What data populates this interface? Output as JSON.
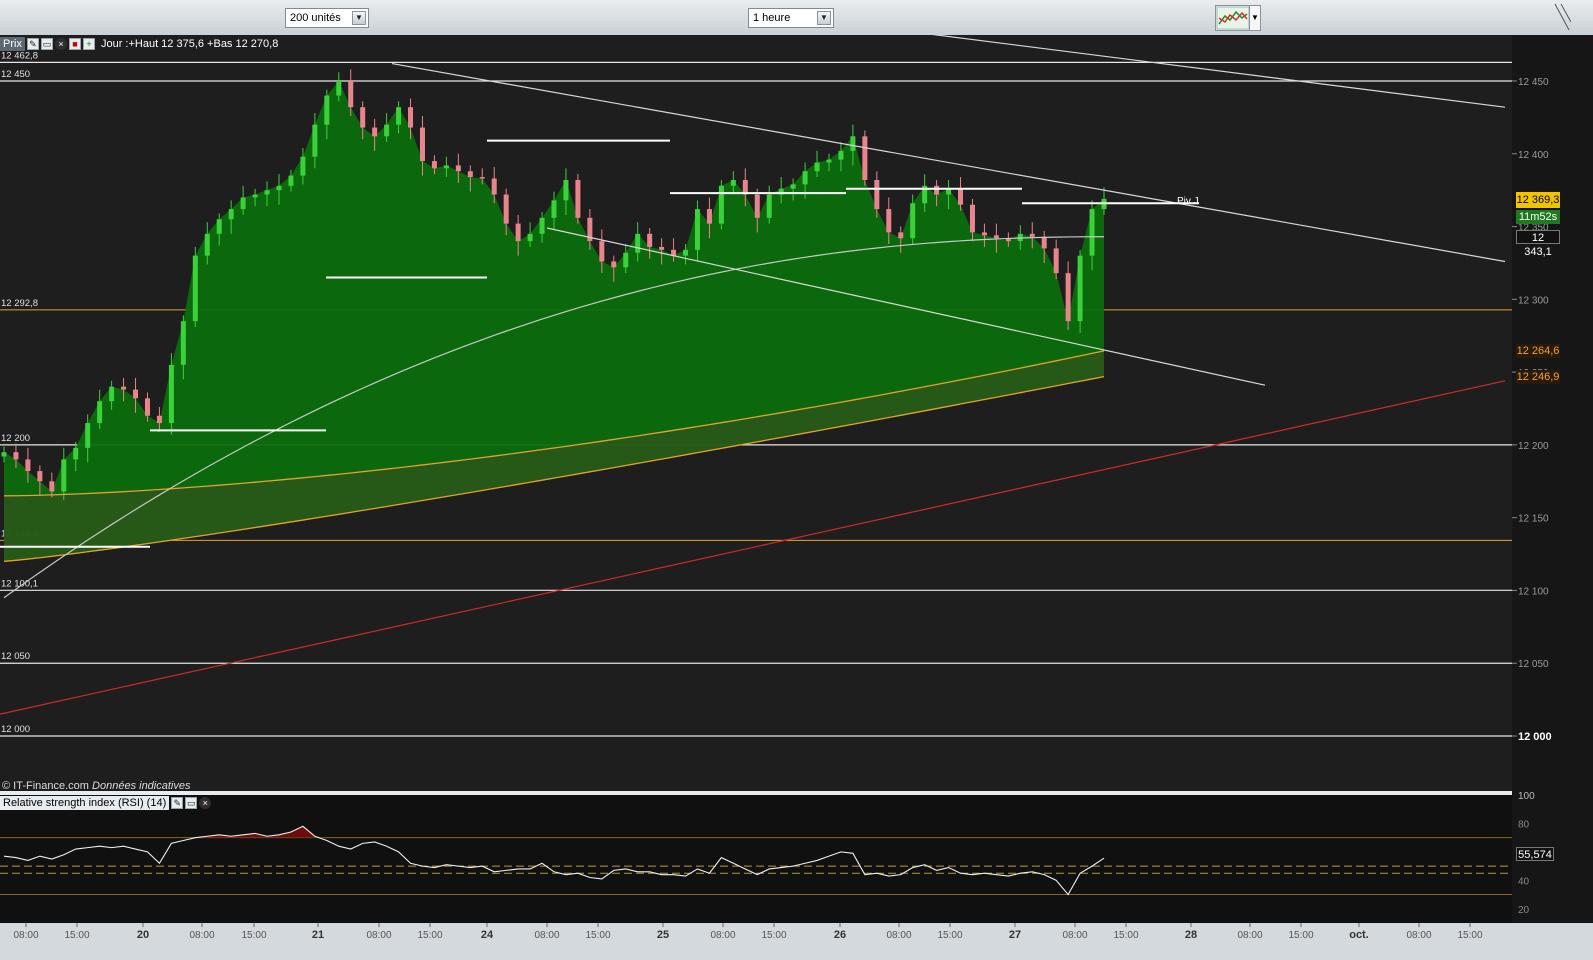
{
  "toolbar": {
    "units_select": "200 unités",
    "period_select": "1 heure",
    "chart_type_icon": "candlestick-chart-icon"
  },
  "price_panel": {
    "label": "Prix",
    "info": "Jour :+Haut 12 375,6 +Bas 12 270,8",
    "copyright": "© IT-Finance.com",
    "disclaimer": "Données indicatives"
  },
  "rsi_panel": {
    "label": "Relative strength index (RSI) (14)",
    "value_label": "55,574"
  },
  "price_boxes": {
    "current": "12 369,3",
    "countdown": "11m52s",
    "ma_fast": "12 343,1",
    "ma_slow1": "12 264,6",
    "ma_slow2": "12 246,9"
  },
  "colors": {
    "background": "#1e1e1e",
    "area_fill": "#0c6d0c",
    "up_candle": "#3bd13b",
    "down_candle": "#e8848c",
    "ma_grey": "#c8c8c8",
    "ma_orange": "#e3a22e",
    "trend_red": "#cf2b2b"
  },
  "chart_data": {
    "type": "line",
    "title": "",
    "x_ticks": [
      "08:00",
      "15:00",
      "20",
      "08:00",
      "15:00",
      "21",
      "08:00",
      "15:00",
      "24",
      "08:00",
      "15:00",
      "25",
      "08:00",
      "15:00",
      "26",
      "08:00",
      "15:00",
      "27",
      "08:00",
      "15:00",
      "28",
      "08:00",
      "15:00",
      "oct.",
      "08:00",
      "15:00"
    ],
    "y_ticks": [
      "12 450",
      "12 400",
      "12 350",
      "12 300",
      "12 250",
      "12 200",
      "12 150",
      "12 100",
      "12 050",
      "12 000"
    ],
    "ylim": [
      11955,
      12480
    ],
    "horizontal_levels": [
      {
        "label": "12 462,8",
        "value": 12462.8,
        "color": "white"
      },
      {
        "label": "12 450",
        "value": 12450,
        "color": "white"
      },
      {
        "label": "12 292,8",
        "value": 12292.8,
        "color": "orange"
      },
      {
        "label": "12 200",
        "value": 12200,
        "color": "white"
      },
      {
        "label": "12 134,4",
        "value": 12134.4,
        "color": "orange"
      },
      {
        "label": "12 100,1",
        "value": 12100.1,
        "color": "white"
      },
      {
        "label": "12 050",
        "value": 12050,
        "color": "white"
      },
      {
        "label": "12 000",
        "value": 12000,
        "color": "white"
      }
    ],
    "pivot_label": "Piv J",
    "price_close": [
      12195,
      12190,
      12182,
      12175,
      12168,
      12190,
      12198,
      12215,
      12230,
      12240,
      12238,
      12232,
      12220,
      12215,
      12255,
      12285,
      12330,
      12345,
      12355,
      12362,
      12370,
      12372,
      12375,
      12378,
      12385,
      12398,
      12420,
      12440,
      12450,
      12432,
      12418,
      12412,
      12420,
      12432,
      12418,
      12395,
      12390,
      12392,
      12388,
      12384,
      12383,
      12372,
      12352,
      12340,
      12345,
      12356,
      12368,
      12382,
      12356,
      12340,
      12326,
      12322,
      12332,
      12345,
      12336,
      12334,
      12330,
      12334,
      12362,
      12352,
      12378,
      12382,
      12372,
      12356,
      12372,
      12376,
      12379,
      12388,
      12394,
      12396,
      12402,
      12412,
      12382,
      12362,
      12346,
      12342,
      12366,
      12378,
      12372,
      12376,
      12365,
      12346,
      12344,
      12342,
      12340,
      12345,
      12343,
      12335,
      12318,
      12285,
      12330,
      12362,
      12369
    ],
    "rsi": {
      "ylim": [
        10,
        100
      ],
      "y_ticks": [
        "100",
        "80",
        "60",
        "40",
        "20"
      ],
      "levels": [
        70,
        50,
        45,
        30
      ],
      "values": [
        57,
        56,
        54,
        57,
        55,
        58,
        62,
        63,
        64,
        63,
        64,
        62,
        60,
        52,
        66,
        68,
        70,
        71,
        72,
        71,
        72,
        73,
        71,
        72,
        74,
        78,
        71,
        68,
        64,
        62,
        66,
        67,
        64,
        60,
        52,
        50,
        49,
        51,
        50,
        49,
        50,
        46,
        47,
        48,
        48,
        52,
        46,
        44,
        45,
        42,
        41,
        47,
        48,
        46,
        46,
        44,
        44,
        43,
        48,
        45,
        56,
        52,
        48,
        44,
        48,
        49,
        50,
        52,
        54,
        57,
        60,
        59,
        44,
        45,
        43,
        44,
        49,
        51,
        47,
        49,
        45,
        44,
        45,
        44,
        43,
        45,
        46,
        44,
        40,
        30,
        45,
        50,
        55.6
      ]
    }
  }
}
